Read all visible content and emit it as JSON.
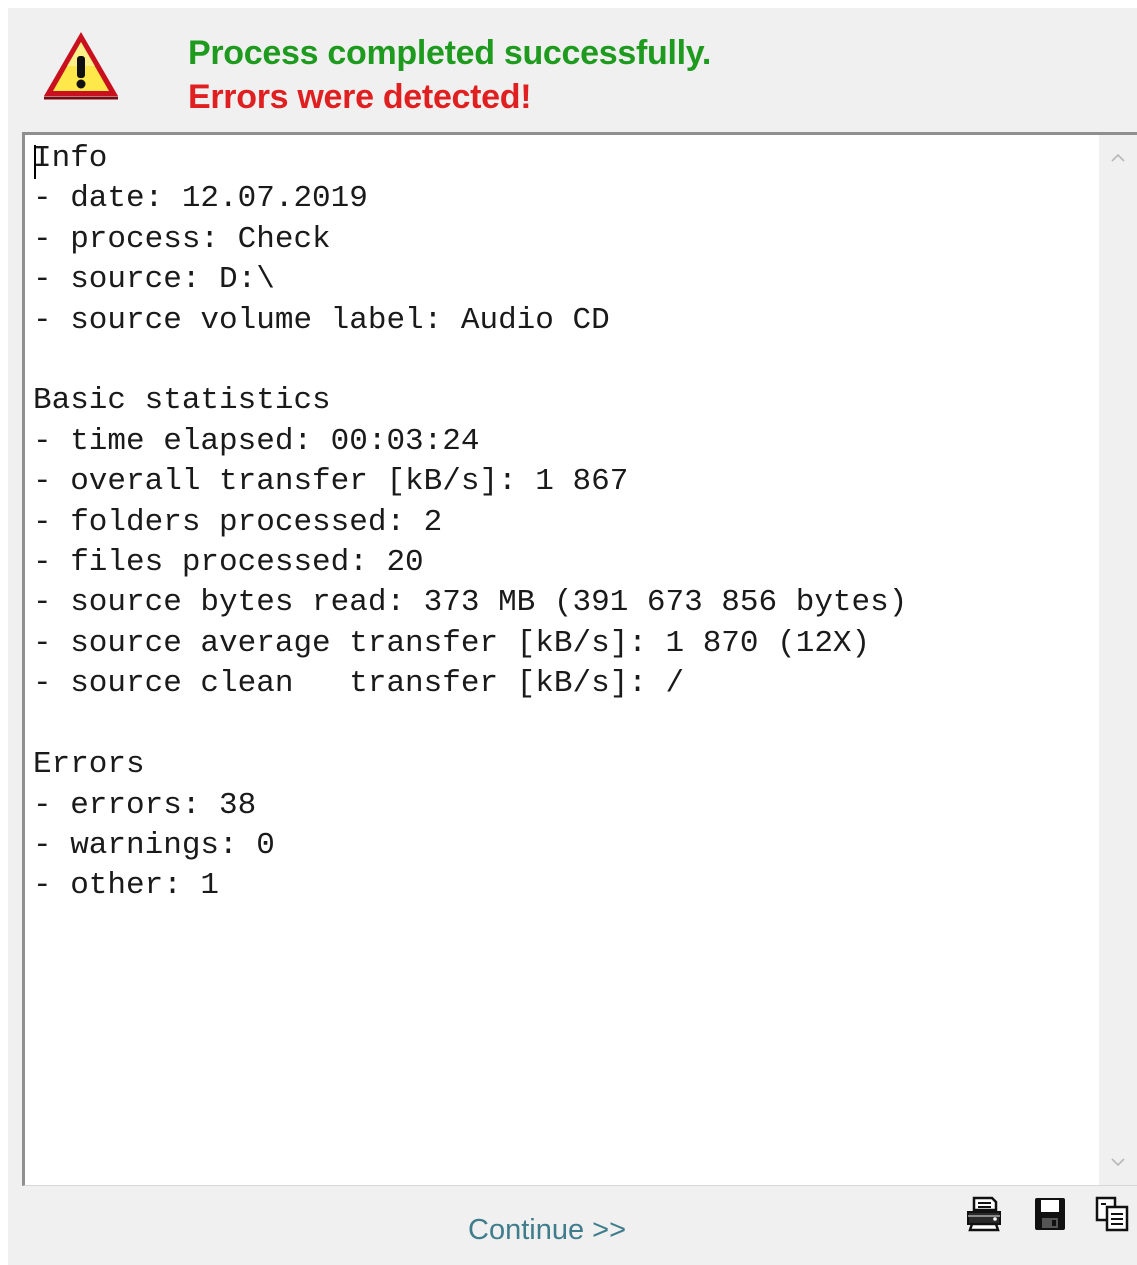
{
  "header": {
    "status_icon": "warning-icon",
    "success_message": "Process completed successfully.",
    "error_message": "Errors were detected!",
    "colors": {
      "success": "#1e9a1e",
      "error": "#e02020"
    }
  },
  "report": {
    "text": "Info\n- date: 12.07.2019\n- process: Check\n- source: D:\\\n- source volume label: Audio CD\n\nBasic statistics\n- time elapsed: 00:03:24\n- overall transfer [kB/s]: 1 867\n- folders processed: 2\n- files processed: 20\n- source bytes read: 373 MB (391 673 856 bytes)\n- source average transfer [kB/s]: 1 870 (12X)\n- source clean   transfer [kB/s]: /\n\nErrors\n- errors: 38\n- warnings: 0\n- other: 1"
  },
  "toolbar": {
    "icons": [
      "printer-icon",
      "save-icon",
      "copy-icon"
    ]
  },
  "footer": {
    "continue_label": "Continue >>"
  }
}
